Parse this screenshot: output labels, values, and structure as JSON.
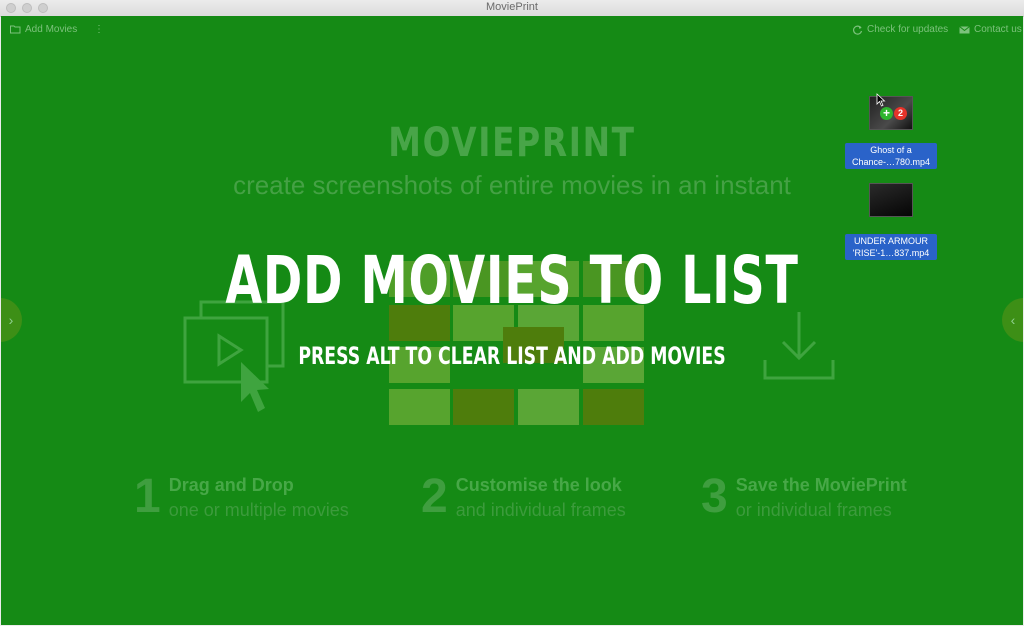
{
  "window": {
    "title": "MoviePrint"
  },
  "toolbar": {
    "add_movies": "Add Movies",
    "more": "⋮",
    "check_updates": "Check for updates",
    "contact": "Contact us"
  },
  "hero": {
    "brand": "MOVIEPRINT",
    "tagline": "create screenshots of entire movies in an instant"
  },
  "overlay": {
    "title": "ADD MOVIES TO LIST",
    "subtitle": "PRESS ALT TO CLEAR LIST AND ADD MOVIES"
  },
  "steps": [
    {
      "num": "1",
      "title": "Drag and Drop",
      "desc": "one or multiple movies"
    },
    {
      "num": "2",
      "title": "Customise the look",
      "desc": "and individual frames"
    },
    {
      "num": "3",
      "title": "Save the MoviePrint",
      "desc": "or individual frames"
    }
  ],
  "desktop_files": [
    {
      "line1": "Ghost of a",
      "line2": "Chance-…780.mp4"
    },
    {
      "line1": "UNDER ARMOUR",
      "line2": "'RISE'-1…837.mp4"
    }
  ],
  "drag_badge": {
    "count": "2"
  },
  "nav": {
    "left": "›",
    "right": "‹"
  },
  "colors": {
    "background": "#158a15",
    "accent": "#ffffff",
    "selection": "#2a63c9"
  }
}
